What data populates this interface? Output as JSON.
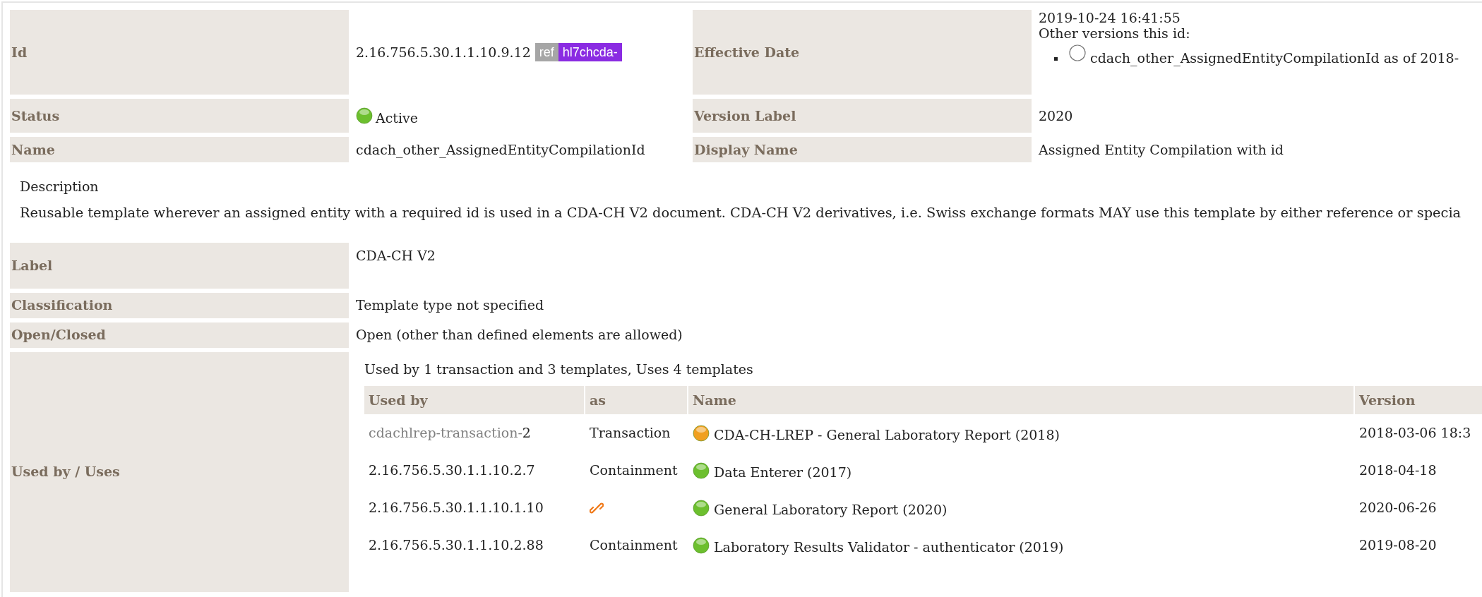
{
  "details": [
    {
      "label": "Id",
      "kind": "id",
      "value": "2.16.756.5.30.1.1.10.9.12",
      "badge": {
        "prefix": "ref",
        "name": "hl7chcda-"
      },
      "label2": "Effective Date",
      "right": {
        "kind": "versions",
        "effective_date": "2019-10-24 16:41:55",
        "other_versions_title": "Other versions this id:",
        "other_versions": [
          {
            "filled": false,
            "text": "cdach_other_AssignedEntityCompilationId as of 2018-"
          }
        ]
      }
    },
    {
      "label": "Status",
      "kind": "status",
      "value": "Active",
      "color": "#6cbf2e",
      "label2": "Version Label",
      "right": {
        "kind": "text",
        "value": "2020"
      }
    },
    {
      "label": "Name",
      "kind": "text",
      "value": "cdach_other_AssignedEntityCompilationId",
      "label2": "Display Name",
      "right": {
        "kind": "text",
        "value": "Assigned Entity Compilation with id"
      }
    }
  ],
  "description": {
    "title": "Description",
    "text": "Reusable template wherever an assigned entity with a required id is used in a CDA-CH V2 document. CDA-CH V2 derivatives, i.e. Swiss exchange formats MAY use this template by either reference or specia"
  },
  "properties": [
    {
      "label": "Label",
      "value": "CDA-CH V2"
    },
    {
      "label": "Classification",
      "value": "Template type not specified"
    },
    {
      "label": "Open/Closed",
      "value": "Open (other than defined elements are allowed)"
    }
  ],
  "usage": {
    "label": "Used by / Uses",
    "summary": "Used by 1 transaction and 3 templates, Uses 4 templates",
    "columns": [
      "Used by",
      "as",
      "Name",
      "Version"
    ],
    "rows": [
      {
        "kind": "text",
        "used_by": "cdachlrep-transaction-",
        "used_by_suffix": "2",
        "as": "Transaction",
        "color": "#f0a020",
        "name": "CDA-CH-LREP - General Laboratory Report (2018)",
        "version": "2018-03-06 18:3"
      },
      {
        "kind": "text",
        "used_by": "2.16.756.5.30.1.1.10.2.7",
        "as": "Containment",
        "color": "#6cbf2e",
        "name": "Data Enterer (2017)",
        "version": "2018-04-18"
      },
      {
        "kind": "link",
        "used_by": "2.16.756.5.30.1.1.10.1.10",
        "color": "#6cbf2e",
        "name": "General Laboratory Report (2020)",
        "version": "2020-06-26"
      },
      {
        "kind": "text",
        "used_by": "2.16.756.5.30.1.1.10.2.88",
        "as": "Containment",
        "color": "#6cbf2e",
        "name": "Laboratory Results Validator - authenticator (2019)",
        "version": "2019-08-20"
      }
    ]
  }
}
